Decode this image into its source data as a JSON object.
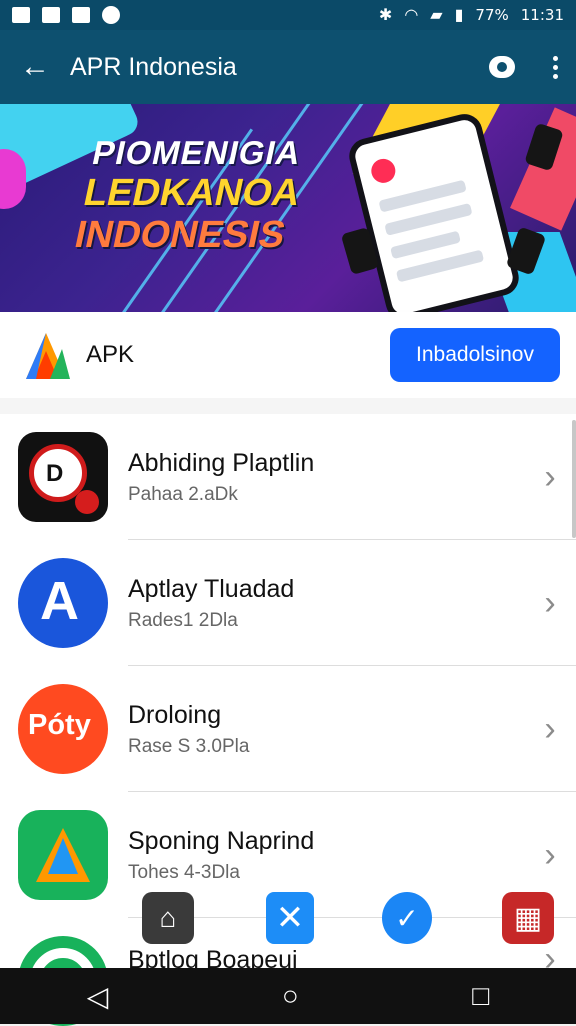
{
  "status_bar": {
    "battery_text": "77%",
    "time": "11:31"
  },
  "appbar": {
    "title": "APR Indonesia"
  },
  "banner": {
    "line1": "PIOMENIGIA",
    "line2": "LEDKANOA",
    "line3": "INDONESIS"
  },
  "apk_section": {
    "label": "APK",
    "button": "Inbadolsinov"
  },
  "apps": [
    {
      "title": "Abhiding Plaptlin",
      "subtitle": "Pahaa 2.aDk"
    },
    {
      "title": "Aptlay Tluadad",
      "subtitle": "Rades1 2Dla"
    },
    {
      "title": "Droloing",
      "subtitle": "Rase S 3.0Pla"
    },
    {
      "title": "Sponing Naprind",
      "subtitle": "Tohes 4-3Dla"
    },
    {
      "title": "Bptlog Boapeui",
      "subtitle": ""
    }
  ],
  "colors": {
    "header": "#0d506f",
    "accent": "#1463ff"
  }
}
